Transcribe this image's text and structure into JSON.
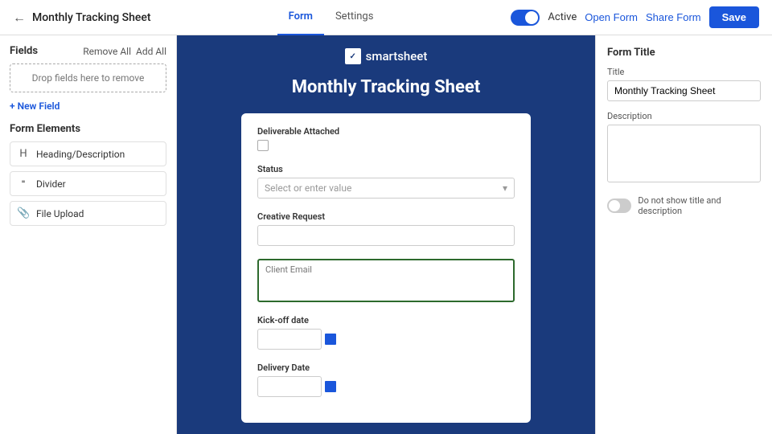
{
  "header": {
    "back_label": "←",
    "title": "Monthly Tracking Sheet",
    "tabs": [
      {
        "label": "Form",
        "active": true
      },
      {
        "label": "Settings",
        "active": false
      }
    ],
    "toggle_label": "Active",
    "open_form_label": "Open Form",
    "share_form_label": "Share Form",
    "save_label": "Save"
  },
  "sidebar": {
    "fields_title": "Fields",
    "remove_all": "Remove All",
    "add_all": "Add All",
    "drop_zone": "Drop fields here to remove",
    "add_field": "+ New Field",
    "form_elements_title": "Form Elements",
    "elements": [
      {
        "icon": "H",
        "label": "Heading/Description"
      },
      {
        "icon": "÷",
        "label": "Divider"
      },
      {
        "icon": "📎",
        "label": "File Upload"
      }
    ]
  },
  "form_preview": {
    "logo_text": "smartsheet",
    "logo_icon": "✓",
    "form_title": "Monthly Tracking Sheet",
    "fields": [
      {
        "label": "Deliverable Attached",
        "type": "checkbox"
      },
      {
        "label": "Status",
        "type": "select",
        "placeholder": "Select or enter value"
      },
      {
        "label": "Creative Request",
        "type": "input"
      },
      {
        "label": "Client Email",
        "type": "textarea-highlighted"
      },
      {
        "label": "Kick-off date",
        "type": "date"
      },
      {
        "label": "Delivery Date",
        "type": "date"
      }
    ]
  },
  "right_panel": {
    "section_title": "Form Title",
    "title_label": "Title",
    "title_value": "Monthly Tracking Sheet",
    "description_label": "Description",
    "description_value": "",
    "toggle_label": "Do not show title and description"
  }
}
